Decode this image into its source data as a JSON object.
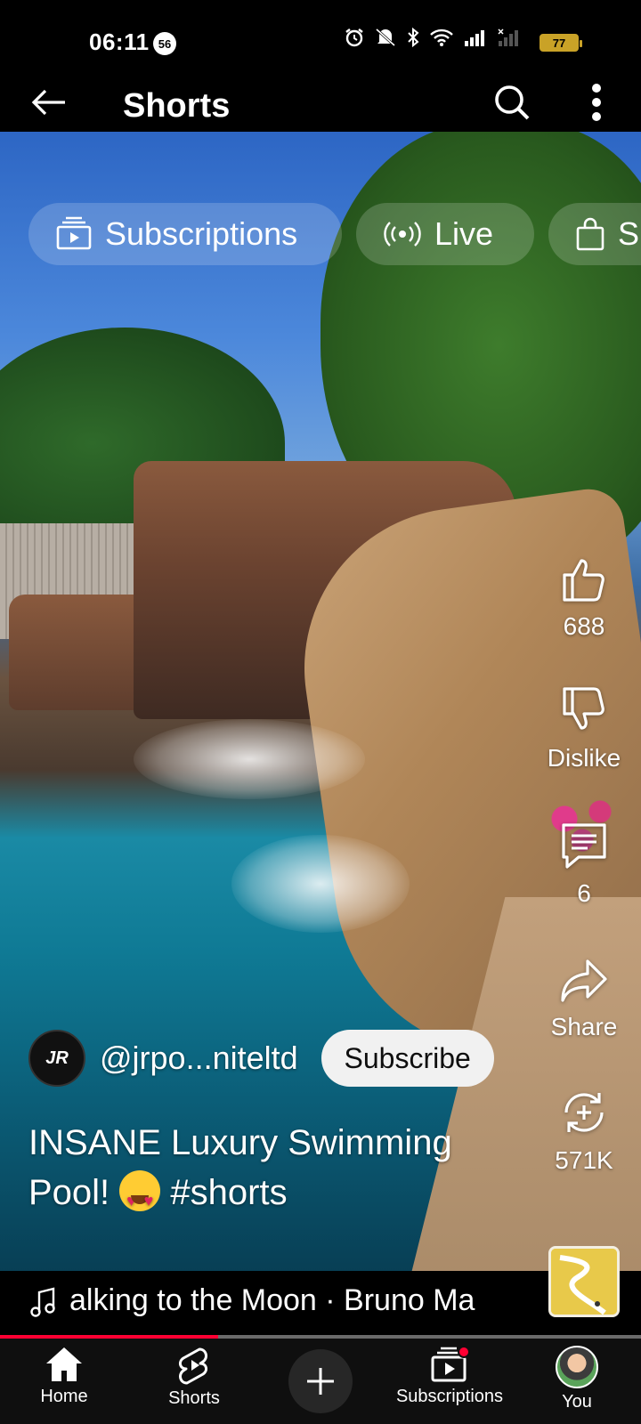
{
  "status_bar": {
    "time": "06:11",
    "notification_count": "56",
    "battery": "77"
  },
  "app_bar": {
    "title": "Shorts"
  },
  "chips": [
    {
      "label": "Subscriptions",
      "icon": "subscriptions-icon"
    },
    {
      "label": "Live",
      "icon": "live-icon"
    },
    {
      "label": "S",
      "icon": "shopping-bag-icon"
    }
  ],
  "actions": {
    "like_count": "688",
    "dislike_label": "Dislike",
    "comment_count": "6",
    "share_label": "Share",
    "remix_count": "571K"
  },
  "channel": {
    "handle": "@jrpo...niteltd",
    "avatar_text": "JR",
    "subscribe_label": "Subscribe"
  },
  "video": {
    "title_part1": "INSANE Luxury Swimming Pool!",
    "title_part2": "#shorts",
    "progress_percent": 34
  },
  "music": {
    "track_text": "alking to the Moon · Bruno Ma"
  },
  "bottom_nav": {
    "home": "Home",
    "shorts": "Shorts",
    "subscriptions": "Subscriptions",
    "you": "You"
  },
  "colors": {
    "accent_red": "#ff0033",
    "subscribe_bg": "#f1f1f1"
  }
}
